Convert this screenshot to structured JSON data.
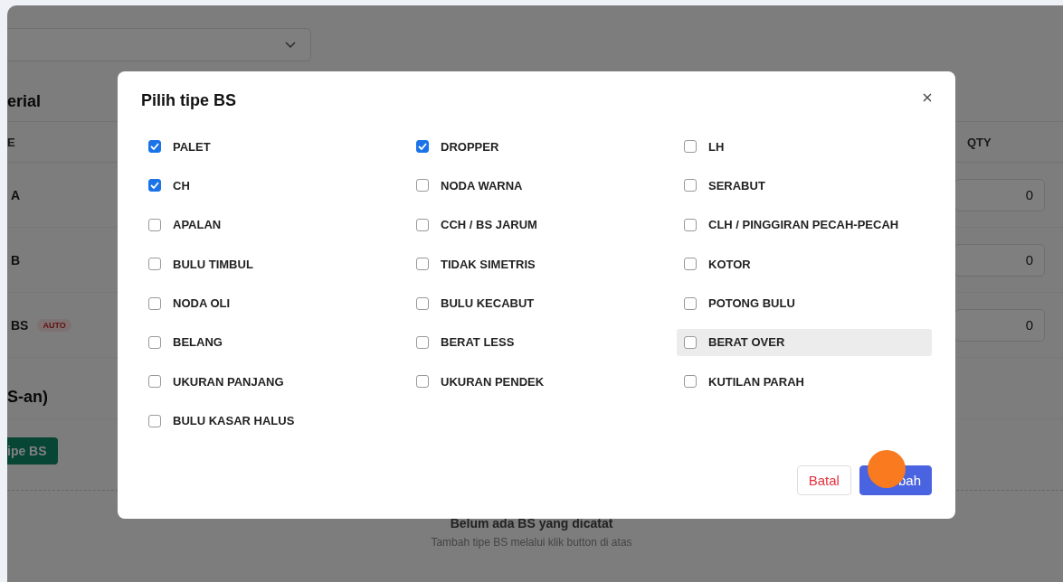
{
  "background": {
    "section_title": "erial",
    "table": {
      "columns": [
        "E",
        "QTY"
      ],
      "rows": [
        {
          "label": "A",
          "qty": "0"
        },
        {
          "label": "B",
          "qty": "0"
        },
        {
          "label": "BS",
          "badge": "AUTO",
          "qty": "0"
        }
      ]
    },
    "section2_title": "S-an)",
    "add_button": "ipe BS",
    "empty_title": "Belum ada BS yang dicatat",
    "empty_hint": "Tambah tipe BS melalui klik button di atas"
  },
  "dialog": {
    "title": "Pilih tipe BS",
    "columns": [
      {
        "items": [
          {
            "label": "PALET",
            "checked": true,
            "hovered": false
          },
          {
            "label": "CH",
            "checked": true,
            "hovered": false
          },
          {
            "label": "APALAN",
            "checked": false,
            "hovered": false
          },
          {
            "label": "BULU TIMBUL",
            "checked": false,
            "hovered": false
          },
          {
            "label": "NODA OLI",
            "checked": false,
            "hovered": false
          },
          {
            "label": "BELANG",
            "checked": false,
            "hovered": false
          },
          {
            "label": "UKURAN PANJANG",
            "checked": false,
            "hovered": false
          },
          {
            "label": "BULU KASAR HALUS",
            "checked": false,
            "hovered": false
          }
        ]
      },
      {
        "items": [
          {
            "label": "DROPPER",
            "checked": true,
            "hovered": false
          },
          {
            "label": "NODA WARNA",
            "checked": false,
            "hovered": false
          },
          {
            "label": "CCH / BS JARUM",
            "checked": false,
            "hovered": false
          },
          {
            "label": "TIDAK SIMETRIS",
            "checked": false,
            "hovered": false
          },
          {
            "label": "BULU KECABUT",
            "checked": false,
            "hovered": false
          },
          {
            "label": "BERAT LESS",
            "checked": false,
            "hovered": false
          },
          {
            "label": "UKURAN PENDEK",
            "checked": false,
            "hovered": false
          }
        ]
      },
      {
        "items": [
          {
            "label": "LH",
            "checked": false,
            "hovered": false
          },
          {
            "label": "SERABUT",
            "checked": false,
            "hovered": false
          },
          {
            "label": "CLH / PINGGIRAN PECAH-PECAH",
            "checked": false,
            "hovered": false
          },
          {
            "label": "KOTOR",
            "checked": false,
            "hovered": false
          },
          {
            "label": "POTONG BULU",
            "checked": false,
            "hovered": false
          },
          {
            "label": "BERAT OVER",
            "checked": false,
            "hovered": true
          },
          {
            "label": "KUTILAN PARAH",
            "checked": false,
            "hovered": false
          }
        ]
      }
    ],
    "buttons": [
      {
        "label": "Batal",
        "kind": "secondary"
      },
      {
        "label": "bah",
        "kind": "primary"
      }
    ]
  }
}
